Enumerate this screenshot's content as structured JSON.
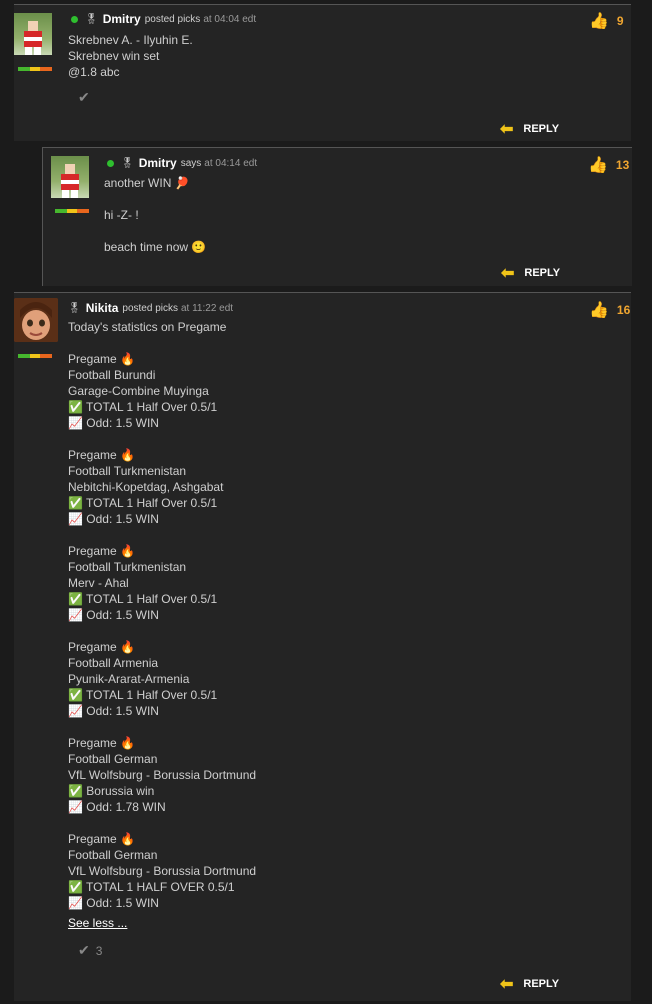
{
  "comments": [
    {
      "user": "Dmitry",
      "verb": "posted picks",
      "time": "at 04:04 edt",
      "likes": "9",
      "body": "Skrebnev A. - Ilyuhin E.\nSkrebnev win set\n@1.8 abc",
      "reply": "REPLY"
    },
    {
      "user": "Dmitry",
      "verb": "says",
      "time": "at 04:14 edt",
      "likes": "13",
      "body": "another WIN 🏓\n\nhi -Z- !\n\nbeach time now 🙂",
      "reply": "REPLY"
    },
    {
      "user": "Nikita",
      "verb": "posted picks",
      "time": "at 11:22 edt",
      "likes": "16",
      "body": "Today's statistics on Pregame\n\nPregame 🔥\nFootball Burundi\nGarage-Combine Muyinga\n✅ TOTAL 1 Half Over 0.5/1\n📈 Odd: 1.5 WIN\n\nPregame 🔥\nFootball Turkmenistan\nNebitchi-Kopetdag, Ashgabat\n✅ TOTAL 1 Half Over 0.5/1\n📈 Odd: 1.5 WIN\n\nPregame 🔥\nFootball Turkmenistan\nMerv - Ahal\n✅ TOTAL 1 Half Over 0.5/1\n📈 Odd: 1.5 WIN\n\nPregame 🔥\nFootball Armenia\nPyunik-Ararat-Armenia\n✅ TOTAL 1 Half Over 0.5/1\n📈 Odd: 1.5 WIN\n\nPregame 🔥\nFootball German\nVfL Wolfsburg - Borussia Dortmund\n✅ Borussia win\n📈 Odd: 1.78 WIN\n\nPregame 🔥\nFootball German\nVfL Wolfsburg - Borussia Dortmund\n✅ TOTAL 1 HALF OVER 0.5/1\n📈 Odd: 1.5 WIN",
      "see_less": "See less ...",
      "check_count": "3",
      "reply": "REPLY"
    }
  ]
}
